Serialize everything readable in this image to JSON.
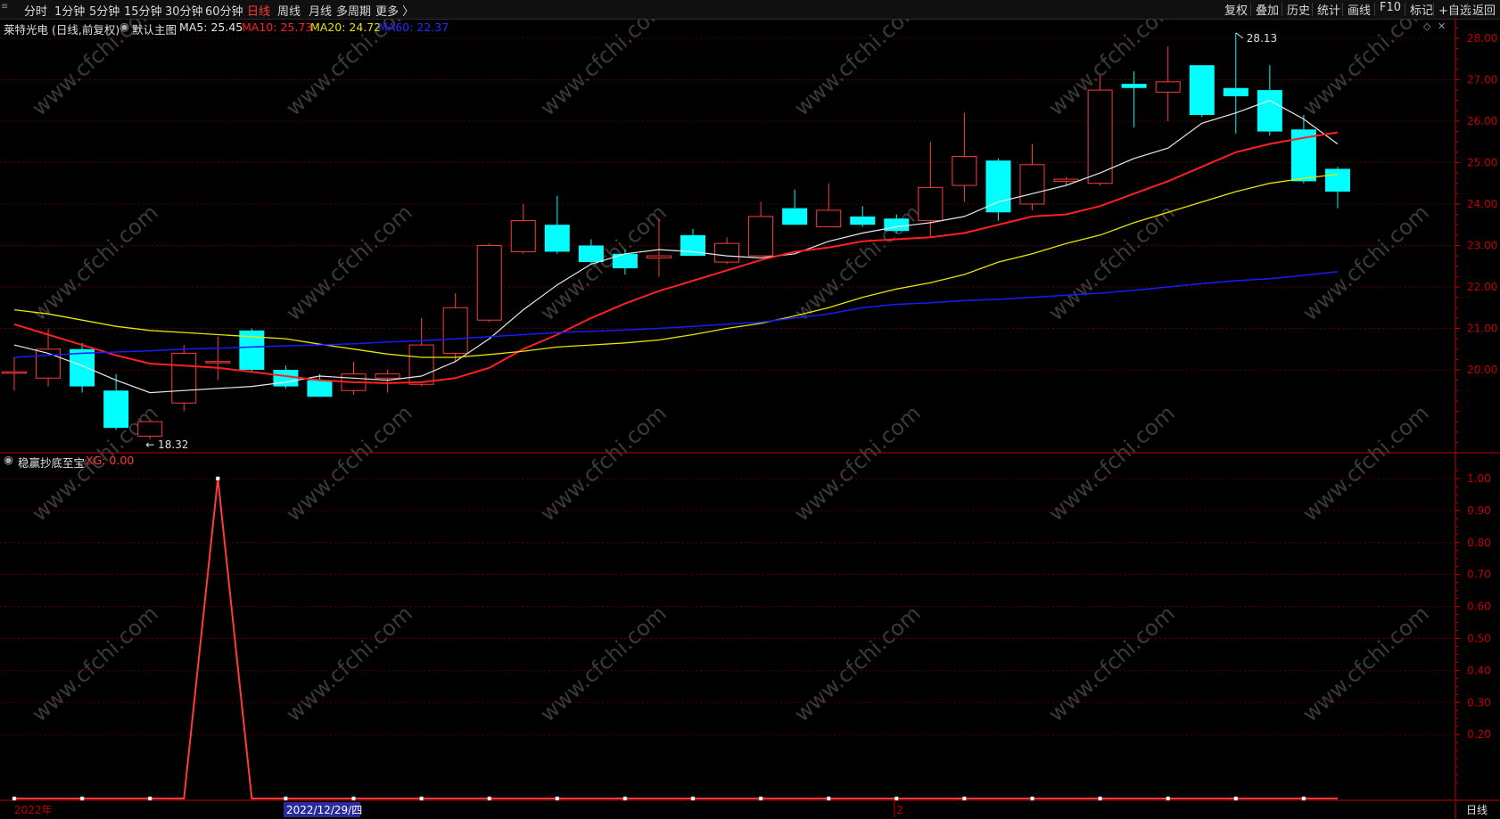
{
  "toolbar": {
    "left_items": [
      {
        "label": "分时",
        "active": false
      },
      {
        "label": "1分钟",
        "active": false
      },
      {
        "label": "5分钟",
        "active": false
      },
      {
        "label": "15分钟",
        "active": false
      },
      {
        "label": "30分钟",
        "active": false
      },
      {
        "label": "60分钟",
        "active": false
      },
      {
        "label": "日线",
        "active": true
      },
      {
        "label": "周线",
        "active": false
      },
      {
        "label": "月线",
        "active": false
      },
      {
        "label": "多周期",
        "active": false
      },
      {
        "label": "更多 〉",
        "active": false
      }
    ],
    "right_items": [
      "复权",
      "叠加",
      "历史",
      "统计",
      "画线",
      "F10",
      "标记",
      "+自选",
      "返回"
    ]
  },
  "main_legend": {
    "stock": "莱特光电 (日线,前复权)",
    "indicator": "默认主图",
    "ma5": "MA5: 25.45",
    "ma10": "MA10: 25.73",
    "ma20": "MA20: 24.72",
    "ma60": "MA60: 22.37"
  },
  "sub_legend": {
    "name": "稳赢抄底至宝",
    "xg": "XG: 0.00"
  },
  "annotations": {
    "high": "28.13",
    "low": "18.32"
  },
  "bottom": {
    "year": "2022年",
    "cursor_date": "2022/12/29/四",
    "month": "2",
    "period": "日线"
  },
  "watermark": "www.cfchi.com",
  "colors": {
    "up": "#ff3b3b",
    "down": "#00ffff",
    "ma5": "#e8e8e8",
    "ma10": "#ff2020",
    "ma20": "#e6e600",
    "ma60": "#1a1aff",
    "axis": "#c00000",
    "grid": "#5a0000"
  },
  "chart_data": [
    {
      "type": "candlestick",
      "ylim": [
        18.0,
        28.3
      ],
      "y_ticks": [
        "20.00",
        "21.00",
        "22.00",
        "23.00",
        "24.00",
        "25.00",
        "26.00",
        "27.00",
        "28.00"
      ],
      "candles": [
        {
          "o": 19.95,
          "h": 20.3,
          "l": 19.5,
          "c": 19.95
        },
        {
          "o": 19.8,
          "h": 21.0,
          "l": 19.6,
          "c": 20.5
        },
        {
          "o": 20.5,
          "h": 20.65,
          "l": 19.45,
          "c": 19.6
        },
        {
          "o": 19.5,
          "h": 19.9,
          "l": 18.55,
          "c": 18.6
        },
        {
          "o": 18.4,
          "h": 18.75,
          "l": 18.32,
          "c": 18.75
        },
        {
          "o": 19.2,
          "h": 20.6,
          "l": 19.0,
          "c": 20.4
        },
        {
          "o": 20.2,
          "h": 20.8,
          "l": 19.75,
          "c": 20.2
        },
        {
          "o": 20.95,
          "h": 21.0,
          "l": 19.95,
          "c": 20.0
        },
        {
          "o": 20.0,
          "h": 20.1,
          "l": 19.55,
          "c": 19.6
        },
        {
          "o": 19.75,
          "h": 19.9,
          "l": 19.35,
          "c": 19.35
        },
        {
          "o": 19.5,
          "h": 20.2,
          "l": 19.4,
          "c": 19.9
        },
        {
          "o": 19.8,
          "h": 20.0,
          "l": 19.45,
          "c": 19.9
        },
        {
          "o": 19.65,
          "h": 21.25,
          "l": 19.6,
          "c": 20.6
        },
        {
          "o": 20.4,
          "h": 21.85,
          "l": 20.2,
          "c": 21.5
        },
        {
          "o": 21.2,
          "h": 23.05,
          "l": 21.15,
          "c": 23.0
        },
        {
          "o": 22.85,
          "h": 24.0,
          "l": 22.8,
          "c": 23.6
        },
        {
          "o": 23.5,
          "h": 24.2,
          "l": 22.8,
          "c": 22.85
        },
        {
          "o": 23.0,
          "h": 23.15,
          "l": 22.55,
          "c": 22.6
        },
        {
          "o": 22.8,
          "h": 22.9,
          "l": 22.3,
          "c": 22.45
        },
        {
          "o": 22.7,
          "h": 23.65,
          "l": 22.25,
          "c": 22.75
        },
        {
          "o": 23.25,
          "h": 23.4,
          "l": 22.75,
          "c": 22.75
        },
        {
          "o": 22.6,
          "h": 23.2,
          "l": 22.55,
          "c": 23.05
        },
        {
          "o": 22.75,
          "h": 24.05,
          "l": 22.75,
          "c": 23.7
        },
        {
          "o": 23.9,
          "h": 24.35,
          "l": 23.5,
          "c": 23.5
        },
        {
          "o": 23.45,
          "h": 24.5,
          "l": 23.45,
          "c": 23.85
        },
        {
          "o": 23.7,
          "h": 23.95,
          "l": 23.45,
          "c": 23.5
        },
        {
          "o": 23.65,
          "h": 23.75,
          "l": 23.3,
          "c": 23.35
        },
        {
          "o": 23.6,
          "h": 25.5,
          "l": 23.2,
          "c": 24.4
        },
        {
          "o": 24.45,
          "h": 26.2,
          "l": 24.05,
          "c": 25.15
        },
        {
          "o": 25.05,
          "h": 25.1,
          "l": 23.6,
          "c": 23.8
        },
        {
          "o": 24.0,
          "h": 25.45,
          "l": 23.85,
          "c": 24.95
        },
        {
          "o": 24.55,
          "h": 24.65,
          "l": 24.45,
          "c": 24.6
        },
        {
          "o": 24.5,
          "h": 27.1,
          "l": 24.45,
          "c": 26.75
        },
        {
          "o": 26.9,
          "h": 27.2,
          "l": 25.85,
          "c": 26.8
        },
        {
          "o": 26.7,
          "h": 27.8,
          "l": 26.0,
          "c": 26.95
        },
        {
          "o": 27.35,
          "h": 27.35,
          "l": 26.1,
          "c": 26.15
        },
        {
          "o": 26.8,
          "h": 28.13,
          "l": 25.7,
          "c": 26.6
        },
        {
          "o": 26.75,
          "h": 27.35,
          "l": 25.65,
          "c": 25.75
        },
        {
          "o": 25.8,
          "h": 26.15,
          "l": 24.5,
          "c": 24.55
        },
        {
          "o": 24.85,
          "h": 24.9,
          "l": 23.9,
          "c": 24.3
        }
      ],
      "series": [
        {
          "name": "MA5",
          "values": [
            20.6,
            20.4,
            20.1,
            19.75,
            19.45,
            19.5,
            19.55,
            19.6,
            19.7,
            19.85,
            19.8,
            19.75,
            19.85,
            20.2,
            20.75,
            21.45,
            22.05,
            22.55,
            22.8,
            22.9,
            22.85,
            22.75,
            22.7,
            22.8,
            23.1,
            23.3,
            23.45,
            23.55,
            23.7,
            24.05,
            24.25,
            24.45,
            24.75,
            25.1,
            25.35,
            25.95,
            26.2,
            26.5,
            26.05,
            25.45
          ]
        },
        {
          "name": "MA10",
          "values": [
            21.1,
            20.85,
            20.6,
            20.35,
            20.15,
            20.1,
            20.05,
            19.95,
            19.85,
            19.75,
            19.7,
            19.68,
            19.7,
            19.8,
            20.05,
            20.5,
            20.85,
            21.25,
            21.6,
            21.9,
            22.15,
            22.4,
            22.65,
            22.85,
            22.95,
            23.1,
            23.15,
            23.2,
            23.3,
            23.5,
            23.7,
            23.75,
            23.95,
            24.25,
            24.55,
            24.9,
            25.25,
            25.45,
            25.6,
            25.73
          ]
        },
        {
          "name": "MA20",
          "values": [
            21.45,
            21.35,
            21.2,
            21.05,
            20.95,
            20.9,
            20.85,
            20.8,
            20.75,
            20.62,
            20.5,
            20.38,
            20.3,
            20.3,
            20.37,
            20.45,
            20.55,
            20.6,
            20.65,
            20.72,
            20.85,
            21.0,
            21.12,
            21.3,
            21.5,
            21.75,
            21.95,
            22.1,
            22.3,
            22.6,
            22.8,
            23.05,
            23.25,
            23.55,
            23.8,
            24.05,
            24.3,
            24.5,
            24.62,
            24.72
          ]
        },
        {
          "name": "MA60",
          "values": [
            20.3,
            20.35,
            20.4,
            20.43,
            20.46,
            20.5,
            20.52,
            20.55,
            20.58,
            20.6,
            20.63,
            20.67,
            20.7,
            20.75,
            20.8,
            20.85,
            20.9,
            20.93,
            20.96,
            21.0,
            21.05,
            21.1,
            21.15,
            21.25,
            21.35,
            21.5,
            21.58,
            21.62,
            21.67,
            21.7,
            21.75,
            21.8,
            21.85,
            21.92,
            22.0,
            22.08,
            22.15,
            22.2,
            22.28,
            22.37
          ]
        }
      ]
    },
    {
      "type": "line",
      "ylim": [
        0,
        1.05
      ],
      "y_ticks": [
        "0.20",
        "0.30",
        "0.40",
        "0.50",
        "0.60",
        "0.70",
        "0.80",
        "0.90",
        "1.00"
      ],
      "series": [
        {
          "name": "XG",
          "values": [
            0,
            0,
            0,
            0,
            0,
            0,
            1,
            0,
            0,
            0,
            0,
            0,
            0,
            0,
            0,
            0,
            0,
            0,
            0,
            0,
            0,
            0,
            0,
            0,
            0,
            0,
            0,
            0,
            0,
            0,
            0,
            0,
            0,
            0,
            0,
            0,
            0,
            0,
            0,
            0
          ]
        }
      ]
    }
  ]
}
